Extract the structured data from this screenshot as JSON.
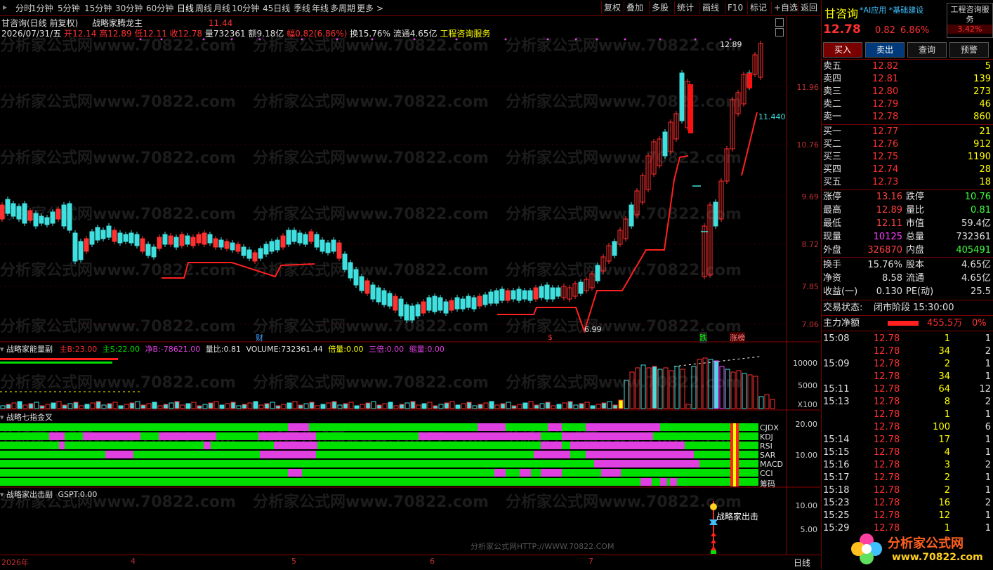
{
  "toolbar": {
    "periods": [
      "分时",
      "1分钟",
      "5分钟",
      "15分钟",
      "30分钟",
      "60分钟",
      "日线",
      "周线",
      "月线",
      "10分钟",
      "45日线",
      "季线",
      "年线",
      "多周期",
      "更多 >"
    ],
    "active": "日线",
    "right": [
      "复权",
      "叠加",
      "多股",
      "统计",
      "画线",
      "F10",
      "标记",
      "+自选",
      "返回"
    ]
  },
  "header": {
    "stock_title": "甘咨询(日线 前复权)",
    "indicator": "战略家腾龙主",
    "indicator_value": "11.44",
    "date": "2026/07/31/五",
    "open_label": "开",
    "open": "12.14",
    "high_label": "高",
    "high": "12.89",
    "low_label": "低",
    "low": "12.11",
    "close_label": "收",
    "close": "12.78",
    "vol_label": "量",
    "vol": "732361",
    "amt_label": "额",
    "amt": "9.18亿",
    "chg_label": "幅",
    "chg": "0.82(6.86%)",
    "turnover_label": "换",
    "turnover": "15.76%",
    "float_label": "流通",
    "float": "4.65亿",
    "industry": "工程咨询服务"
  },
  "price_axis": [
    "11.96",
    "10.76",
    "9.69",
    "8.72",
    "7.85",
    "7.06"
  ],
  "annotations": {
    "high_mark": "12.89",
    "low_mark": "6.99",
    "line_value": "11.440",
    "cai": "财",
    "dollar": "$",
    "die": "跌",
    "zhangbang": "涨榜"
  },
  "panel2": {
    "title": "战略家能量副",
    "zhuB_label": "主B:",
    "zhuB": "23.00",
    "zhuS_label": "主S:",
    "zhuS": "22.00",
    "jingB_label": "净B:",
    "jingB": "-78621.00",
    "liangbi_label": "量比:",
    "liangbi": "0.81",
    "volume_label": "VOLUME:",
    "volume": "732361.44",
    "beiliang_label": "倍量:",
    "beiliang": "0.00",
    "sanbei_label": "三倍:",
    "sanbei": "0.00",
    "suoliang_label": "缩量:",
    "suoliang": "0.00",
    "axis": [
      "10000",
      "5000"
    ],
    "unit": "X100"
  },
  "panel3": {
    "title": "战略七指金叉",
    "axis": [
      "20.00",
      "10.00"
    ],
    "rows": [
      "CJDX",
      "KDJ",
      "RSI",
      "SAR",
      "MACD",
      "CCI",
      "筹码"
    ]
  },
  "panel4": {
    "title": "战略家出击副",
    "gspt_label": "GSPT:",
    "gspt": "0.00",
    "axis": [
      "10.00",
      "5.00"
    ],
    "signal_label": "战略家出击"
  },
  "xaxis": [
    "2026年",
    "4",
    "5",
    "6",
    "7"
  ],
  "period_label": "日线",
  "footer_wm": "分析家公式网HTTP://WWW.70822.COM",
  "watermark": "分析家公式网www.70822.com",
  "side": {
    "name": "甘咨询",
    "tags": "*AI应用 *基础建设",
    "industry_box": "工程咨询服务",
    "industry_chg": "3.42%",
    "price": "12.78",
    "change": "0.82",
    "pct": "6.86%",
    "buttons": [
      "买入",
      "卖出",
      "查询",
      "预警"
    ],
    "asks": [
      {
        "label": "卖五",
        "price": "12.82",
        "vol": "5"
      },
      {
        "label": "卖四",
        "price": "12.81",
        "vol": "139"
      },
      {
        "label": "卖三",
        "price": "12.80",
        "vol": "273"
      },
      {
        "label": "卖二",
        "price": "12.79",
        "vol": "46"
      },
      {
        "label": "卖一",
        "price": "12.78",
        "vol": "860"
      }
    ],
    "bids": [
      {
        "label": "买一",
        "price": "12.77",
        "vol": "21"
      },
      {
        "label": "买二",
        "price": "12.76",
        "vol": "912"
      },
      {
        "label": "买三",
        "price": "12.75",
        "vol": "1190"
      },
      {
        "label": "买四",
        "price": "12.74",
        "vol": "28"
      },
      {
        "label": "买五",
        "price": "12.73",
        "vol": "18"
      }
    ],
    "stats": [
      {
        "l1": "涨停",
        "v1": "13.16",
        "c1": "#ff4040",
        "l2": "跌停",
        "v2": "10.76",
        "c2": "#40ff40"
      },
      {
        "l1": "最高",
        "v1": "12.89",
        "c1": "#ff4040",
        "l2": "量比",
        "v2": "0.81",
        "c2": "#40ff40"
      },
      {
        "l1": "最低",
        "v1": "12.11",
        "c1": "#ff4040",
        "l2": "市值",
        "v2": "59.4亿",
        "c2": "#e0e0e0"
      },
      {
        "l1": "现量",
        "v1": "10125",
        "c1": "#ff40ff",
        "l2": "总量",
        "v2": "732361",
        "c2": "#e0e0e0"
      },
      {
        "l1": "外盘",
        "v1": "326870",
        "c1": "#ff4040",
        "l2": "内盘",
        "v2": "405491",
        "c2": "#40ff40"
      }
    ],
    "stats2": [
      {
        "l1": "换手",
        "v1": "15.76%",
        "l2": "股本",
        "v2": "4.65亿"
      },
      {
        "l1": "净资",
        "v1": "8.58",
        "l2": "流通",
        "v2": "4.65亿"
      },
      {
        "l1": "收益(一)",
        "v1": "0.130",
        "l2": "PE(动)",
        "v2": "25.5"
      }
    ],
    "status_label": "交易状态:",
    "status": "闭市阶段 15:30:00",
    "netflow_label": "主力净额",
    "netflow": "455.5万",
    "netflow_pct": "0%",
    "trades": [
      {
        "t": "15:08",
        "p": "12.78",
        "v": "1",
        "n": "1"
      },
      {
        "t": "",
        "p": "12.78",
        "v": "34",
        "n": "2"
      },
      {
        "t": "15:09",
        "p": "12.78",
        "v": "2",
        "n": "1"
      },
      {
        "t": "",
        "p": "12.78",
        "v": "34",
        "n": "1"
      },
      {
        "t": "15:11",
        "p": "12.78",
        "v": "64",
        "n": "12"
      },
      {
        "t": "15:13",
        "p": "12.78",
        "v": "8",
        "n": "2"
      },
      {
        "t": "",
        "p": "12.78",
        "v": "1",
        "n": "1"
      },
      {
        "t": "",
        "p": "12.78",
        "v": "100",
        "n": "6"
      },
      {
        "t": "15:14",
        "p": "12.78",
        "v": "17",
        "n": "1"
      },
      {
        "t": "15:15",
        "p": "12.78",
        "v": "4",
        "n": "1"
      },
      {
        "t": "15:16",
        "p": "12.78",
        "v": "3",
        "n": "2"
      },
      {
        "t": "15:17",
        "p": "12.78",
        "v": "2",
        "n": "1"
      },
      {
        "t": "15:18",
        "p": "12.78",
        "v": "2",
        "n": "1"
      },
      {
        "t": "15:23",
        "p": "12.78",
        "v": "16",
        "n": "2"
      },
      {
        "t": "15:25",
        "p": "12.78",
        "v": "12",
        "n": "1"
      },
      {
        "t": "15:29",
        "p": "12.78",
        "v": "1",
        "n": "1"
      }
    ],
    "logo_text": "分析家公式网",
    "logo_url": "www.70822.com"
  },
  "colors": {
    "up": "#ff3030",
    "down": "#40e0e0",
    "green": "#00e000",
    "magenta": "#e040e0",
    "grid": "#8b0000"
  }
}
